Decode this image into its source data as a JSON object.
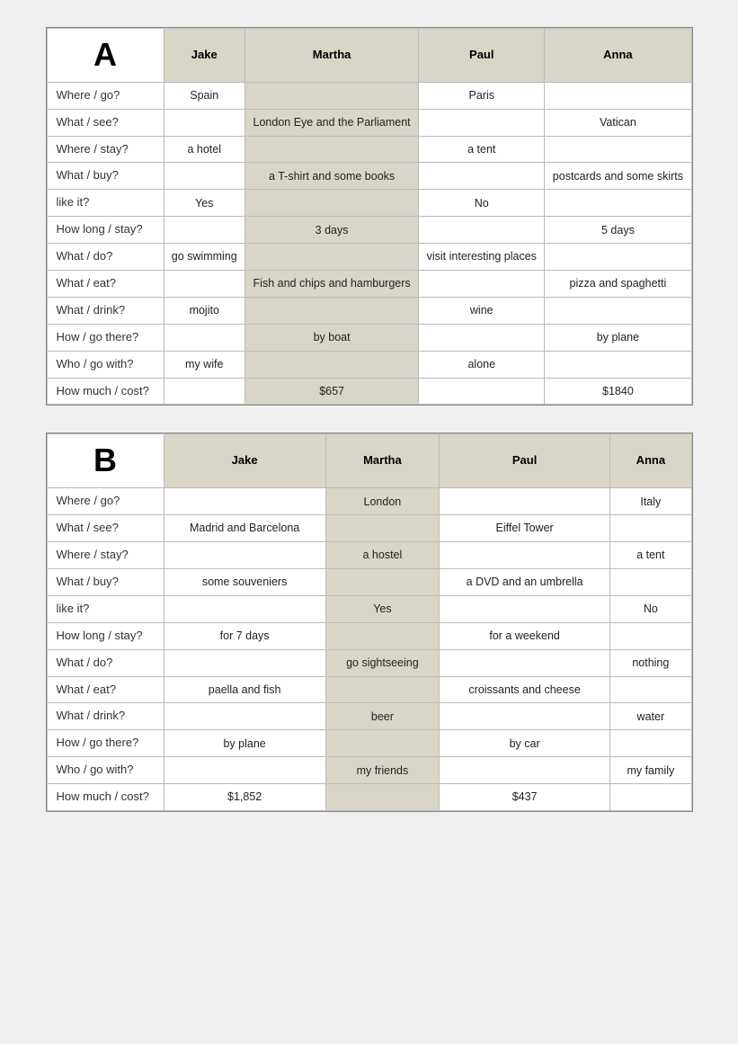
{
  "tableA": {
    "letter": "A",
    "headers": [
      "",
      "Jake",
      "Martha",
      "Paul",
      "Anna"
    ],
    "rows": [
      {
        "label": "Where / go?",
        "jake": "Spain",
        "martha": "",
        "paul": "Paris",
        "anna": ""
      },
      {
        "label": "What / see?",
        "jake": "",
        "martha": "London Eye and the Parliament",
        "paul": "",
        "anna": "Vatican"
      },
      {
        "label": "Where / stay?",
        "jake": "a hotel",
        "martha": "",
        "paul": "a tent",
        "anna": ""
      },
      {
        "label": "What / buy?",
        "jake": "",
        "martha": "a T-shirt and some books",
        "paul": "",
        "anna": "postcards and some skirts"
      },
      {
        "label": "like it?",
        "jake": "Yes",
        "martha": "",
        "paul": "No",
        "anna": ""
      },
      {
        "label": "How long / stay?",
        "jake": "",
        "martha": "3 days",
        "paul": "",
        "anna": "5 days"
      },
      {
        "label": "What / do?",
        "jake": "go swimming",
        "martha": "",
        "paul": "visit interesting places",
        "anna": ""
      },
      {
        "label": "What / eat?",
        "jake": "",
        "martha": "Fish and chips and hamburgers",
        "paul": "",
        "anna": "pizza and spaghetti"
      },
      {
        "label": "What / drink?",
        "jake": "mojito",
        "martha": "",
        "paul": "wine",
        "anna": ""
      },
      {
        "label": "How / go there?",
        "jake": "",
        "martha": "by boat",
        "paul": "",
        "anna": "by plane"
      },
      {
        "label": "Who / go with?",
        "jake": "my wife",
        "martha": "",
        "paul": "alone",
        "anna": ""
      },
      {
        "label": "How much / cost?",
        "jake": "",
        "martha": "$657",
        "paul": "",
        "anna": "$1840"
      }
    ]
  },
  "tableB": {
    "letter": "B",
    "headers": [
      "",
      "Jake",
      "Martha",
      "Paul",
      "Anna"
    ],
    "rows": [
      {
        "label": "Where / go?",
        "jake": "",
        "martha": "London",
        "paul": "",
        "anna": "Italy"
      },
      {
        "label": "What / see?",
        "jake": "Madrid and Barcelona",
        "martha": "",
        "paul": "Eiffel Tower",
        "anna": ""
      },
      {
        "label": "Where / stay?",
        "jake": "",
        "martha": "a hostel",
        "paul": "",
        "anna": "a tent"
      },
      {
        "label": "What / buy?",
        "jake": "some souveniers",
        "martha": "",
        "paul": "a DVD and an umbrella",
        "anna": ""
      },
      {
        "label": "like it?",
        "jake": "",
        "martha": "Yes",
        "paul": "",
        "anna": "No"
      },
      {
        "label": "How long / stay?",
        "jake": "for 7 days",
        "martha": "",
        "paul": "for a weekend",
        "anna": ""
      },
      {
        "label": "What / do?",
        "jake": "",
        "martha": "go sightseeing",
        "paul": "",
        "anna": "nothing"
      },
      {
        "label": "What / eat?",
        "jake": "paella and fish",
        "martha": "",
        "paul": "croissants and cheese",
        "anna": ""
      },
      {
        "label": "What / drink?",
        "jake": "",
        "martha": "beer",
        "paul": "",
        "anna": "water"
      },
      {
        "label": "How / go there?",
        "jake": "by plane",
        "martha": "",
        "paul": "by car",
        "anna": ""
      },
      {
        "label": "Who / go with?",
        "jake": "",
        "martha": "my friends",
        "paul": "",
        "anna": "my family"
      },
      {
        "label": "How much / cost?",
        "jake": "$1,852",
        "martha": "",
        "paul": "$437",
        "anna": ""
      }
    ]
  }
}
